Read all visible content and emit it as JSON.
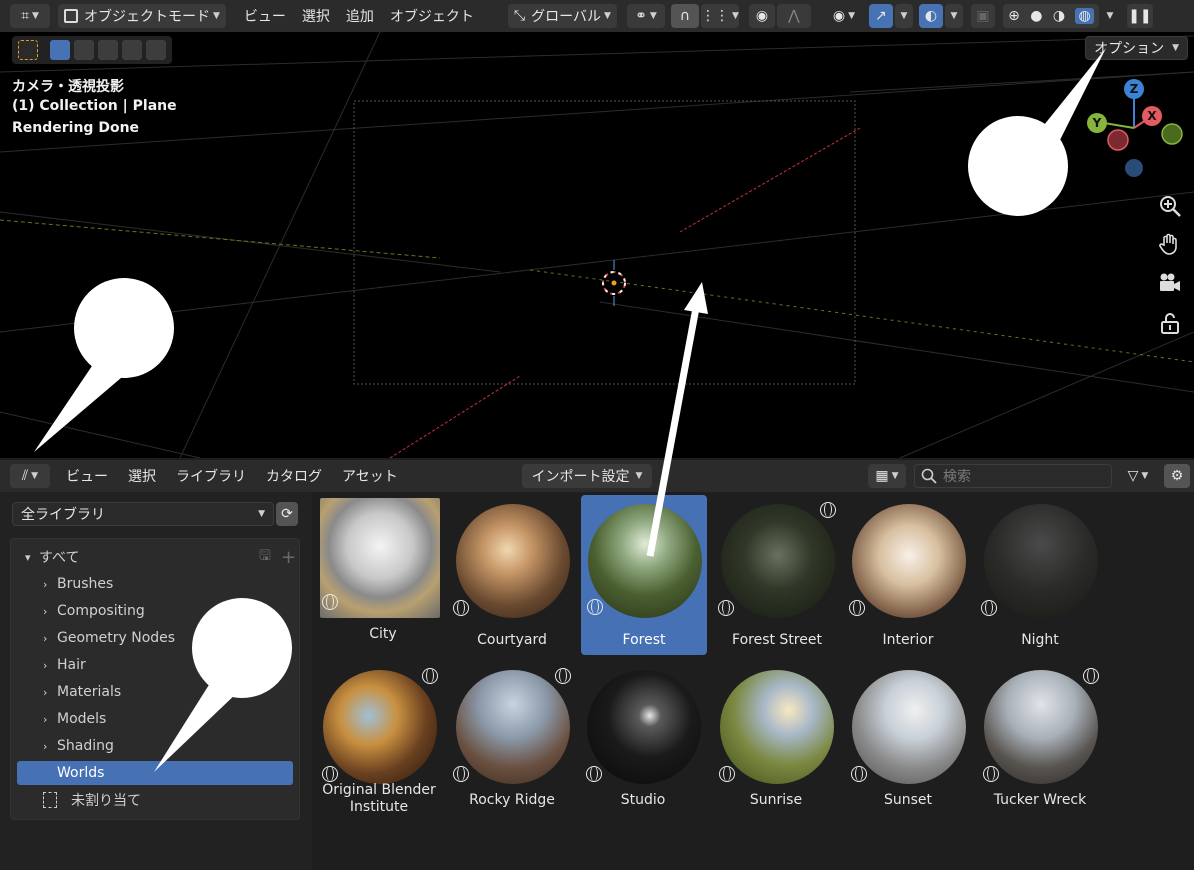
{
  "topbar": {
    "mode_label": "オブジェクトモード",
    "menus": [
      "ビュー",
      "選択",
      "追加",
      "オブジェクト"
    ],
    "transform_orientation": "グローバル"
  },
  "viewport": {
    "info_lines": [
      "カメラ・透視投影",
      "(1) Collection | Plane",
      "Rendering Done"
    ],
    "options_label": "オプション",
    "gizmo_axes": {
      "z": "Z",
      "y": "Y",
      "x": "X"
    },
    "colors": {
      "x_axis": "#e25a62",
      "y_axis": "#87b43a",
      "z_axis": "#3c82d6",
      "grid_x": "#c8303c",
      "grid_y": "#8db535"
    }
  },
  "asset_browser": {
    "menus": [
      "ビュー",
      "選択",
      "ライブラリ",
      "カタログ",
      "アセット"
    ],
    "import_label": "インポート設定",
    "search_placeholder": "検索",
    "library_select": "全ライブラリ",
    "catalog_root": "すべて",
    "catalogs": [
      "Brushes",
      "Compositing",
      "Geometry Nodes",
      "Hair",
      "Materials",
      "Models",
      "Shading",
      "Worlds"
    ],
    "selected_catalog": "Worlds",
    "unassigned": "未割り当て",
    "assets": [
      {
        "label": "City",
        "selected": false
      },
      {
        "label": "Courtyard",
        "selected": false
      },
      {
        "label": "Forest",
        "selected": true
      },
      {
        "label": "Forest Street",
        "selected": false
      },
      {
        "label": "Interior",
        "selected": false
      },
      {
        "label": "Night",
        "selected": false
      },
      {
        "label": "Original Blender Institute",
        "selected": false
      },
      {
        "label": "Rocky Ridge",
        "selected": false
      },
      {
        "label": "Studio",
        "selected": false
      },
      {
        "label": "Sunrise",
        "selected": false
      },
      {
        "label": "Sunset",
        "selected": false
      },
      {
        "label": "Tucker Wreck",
        "selected": false
      }
    ]
  }
}
